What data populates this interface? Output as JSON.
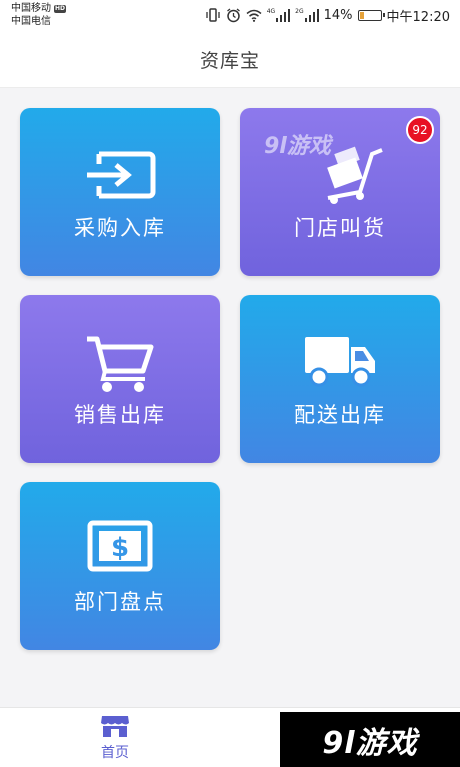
{
  "status_bar": {
    "carrier_1": "中国移动",
    "hd_badge": "HD",
    "carrier_2": "中国电信",
    "net_1": "4G",
    "net_2": "2G",
    "battery_percent": "14%",
    "battery_level": 0.14,
    "time": "中午12:20"
  },
  "header": {
    "title": "资库宝"
  },
  "tiles": [
    {
      "label": "采购入库",
      "icon": "input-arrow-icon"
    },
    {
      "label": "门店叫货",
      "icon": "cart-boxes-icon",
      "badge": "92",
      "watermark": "9l游戏"
    },
    {
      "label": "销售出库",
      "icon": "shopping-cart-icon"
    },
    {
      "label": "配送出库",
      "icon": "truck-icon"
    },
    {
      "label": "部门盘点",
      "icon": "dollar-bill-icon"
    }
  ],
  "bottom_nav": {
    "home_label": "首页",
    "home_icon": "storefront-icon",
    "active_color": "#5b5fd0"
  },
  "watermark": {
    "text": "9l游戏"
  },
  "colors": {
    "blue_tile_top": "#22aaea",
    "blue_tile_bottom": "#4286e3",
    "purple_tile_top": "#8d79ec",
    "purple_tile_bottom": "#7063dd",
    "badge": "#e81123"
  }
}
